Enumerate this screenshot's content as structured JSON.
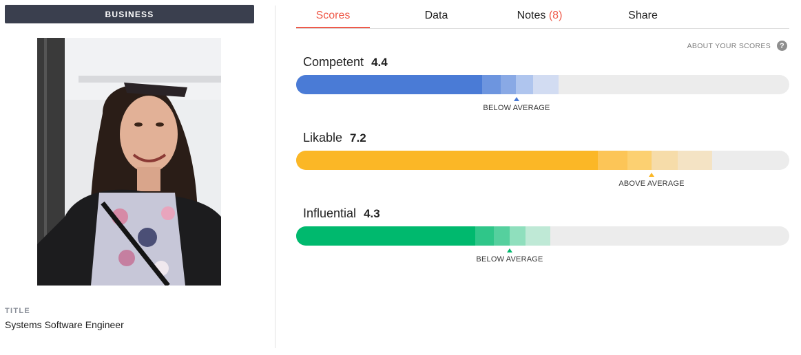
{
  "profile": {
    "category": "BUSINESS",
    "title_label": "TITLE",
    "title_value": "Systems Software Engineer"
  },
  "tabs": [
    {
      "label": "Scores",
      "active": true
    },
    {
      "label": "Data"
    },
    {
      "label": "Notes",
      "count": "(8)"
    },
    {
      "label": "Share"
    }
  ],
  "about_scores": {
    "label": "ABOUT YOUR SCORES",
    "icon": "help-circle-icon"
  },
  "metrics": [
    {
      "name": "Competent",
      "score": "4.4",
      "comparison": "BELOW AVERAGE",
      "color": "#4a7bd6",
      "level": 0.44,
      "average_marker": 0.44
    },
    {
      "name": "Likable",
      "score": "7.2",
      "comparison": "ABOVE AVERAGE",
      "color": "#fbb726",
      "level": 0.61,
      "average_marker": 0.72
    },
    {
      "name": "Influential",
      "score": "4.3",
      "comparison": "BELOW AVERAGE",
      "color": "#00b96e",
      "level": 0.36,
      "average_marker": 0.43
    }
  ]
}
